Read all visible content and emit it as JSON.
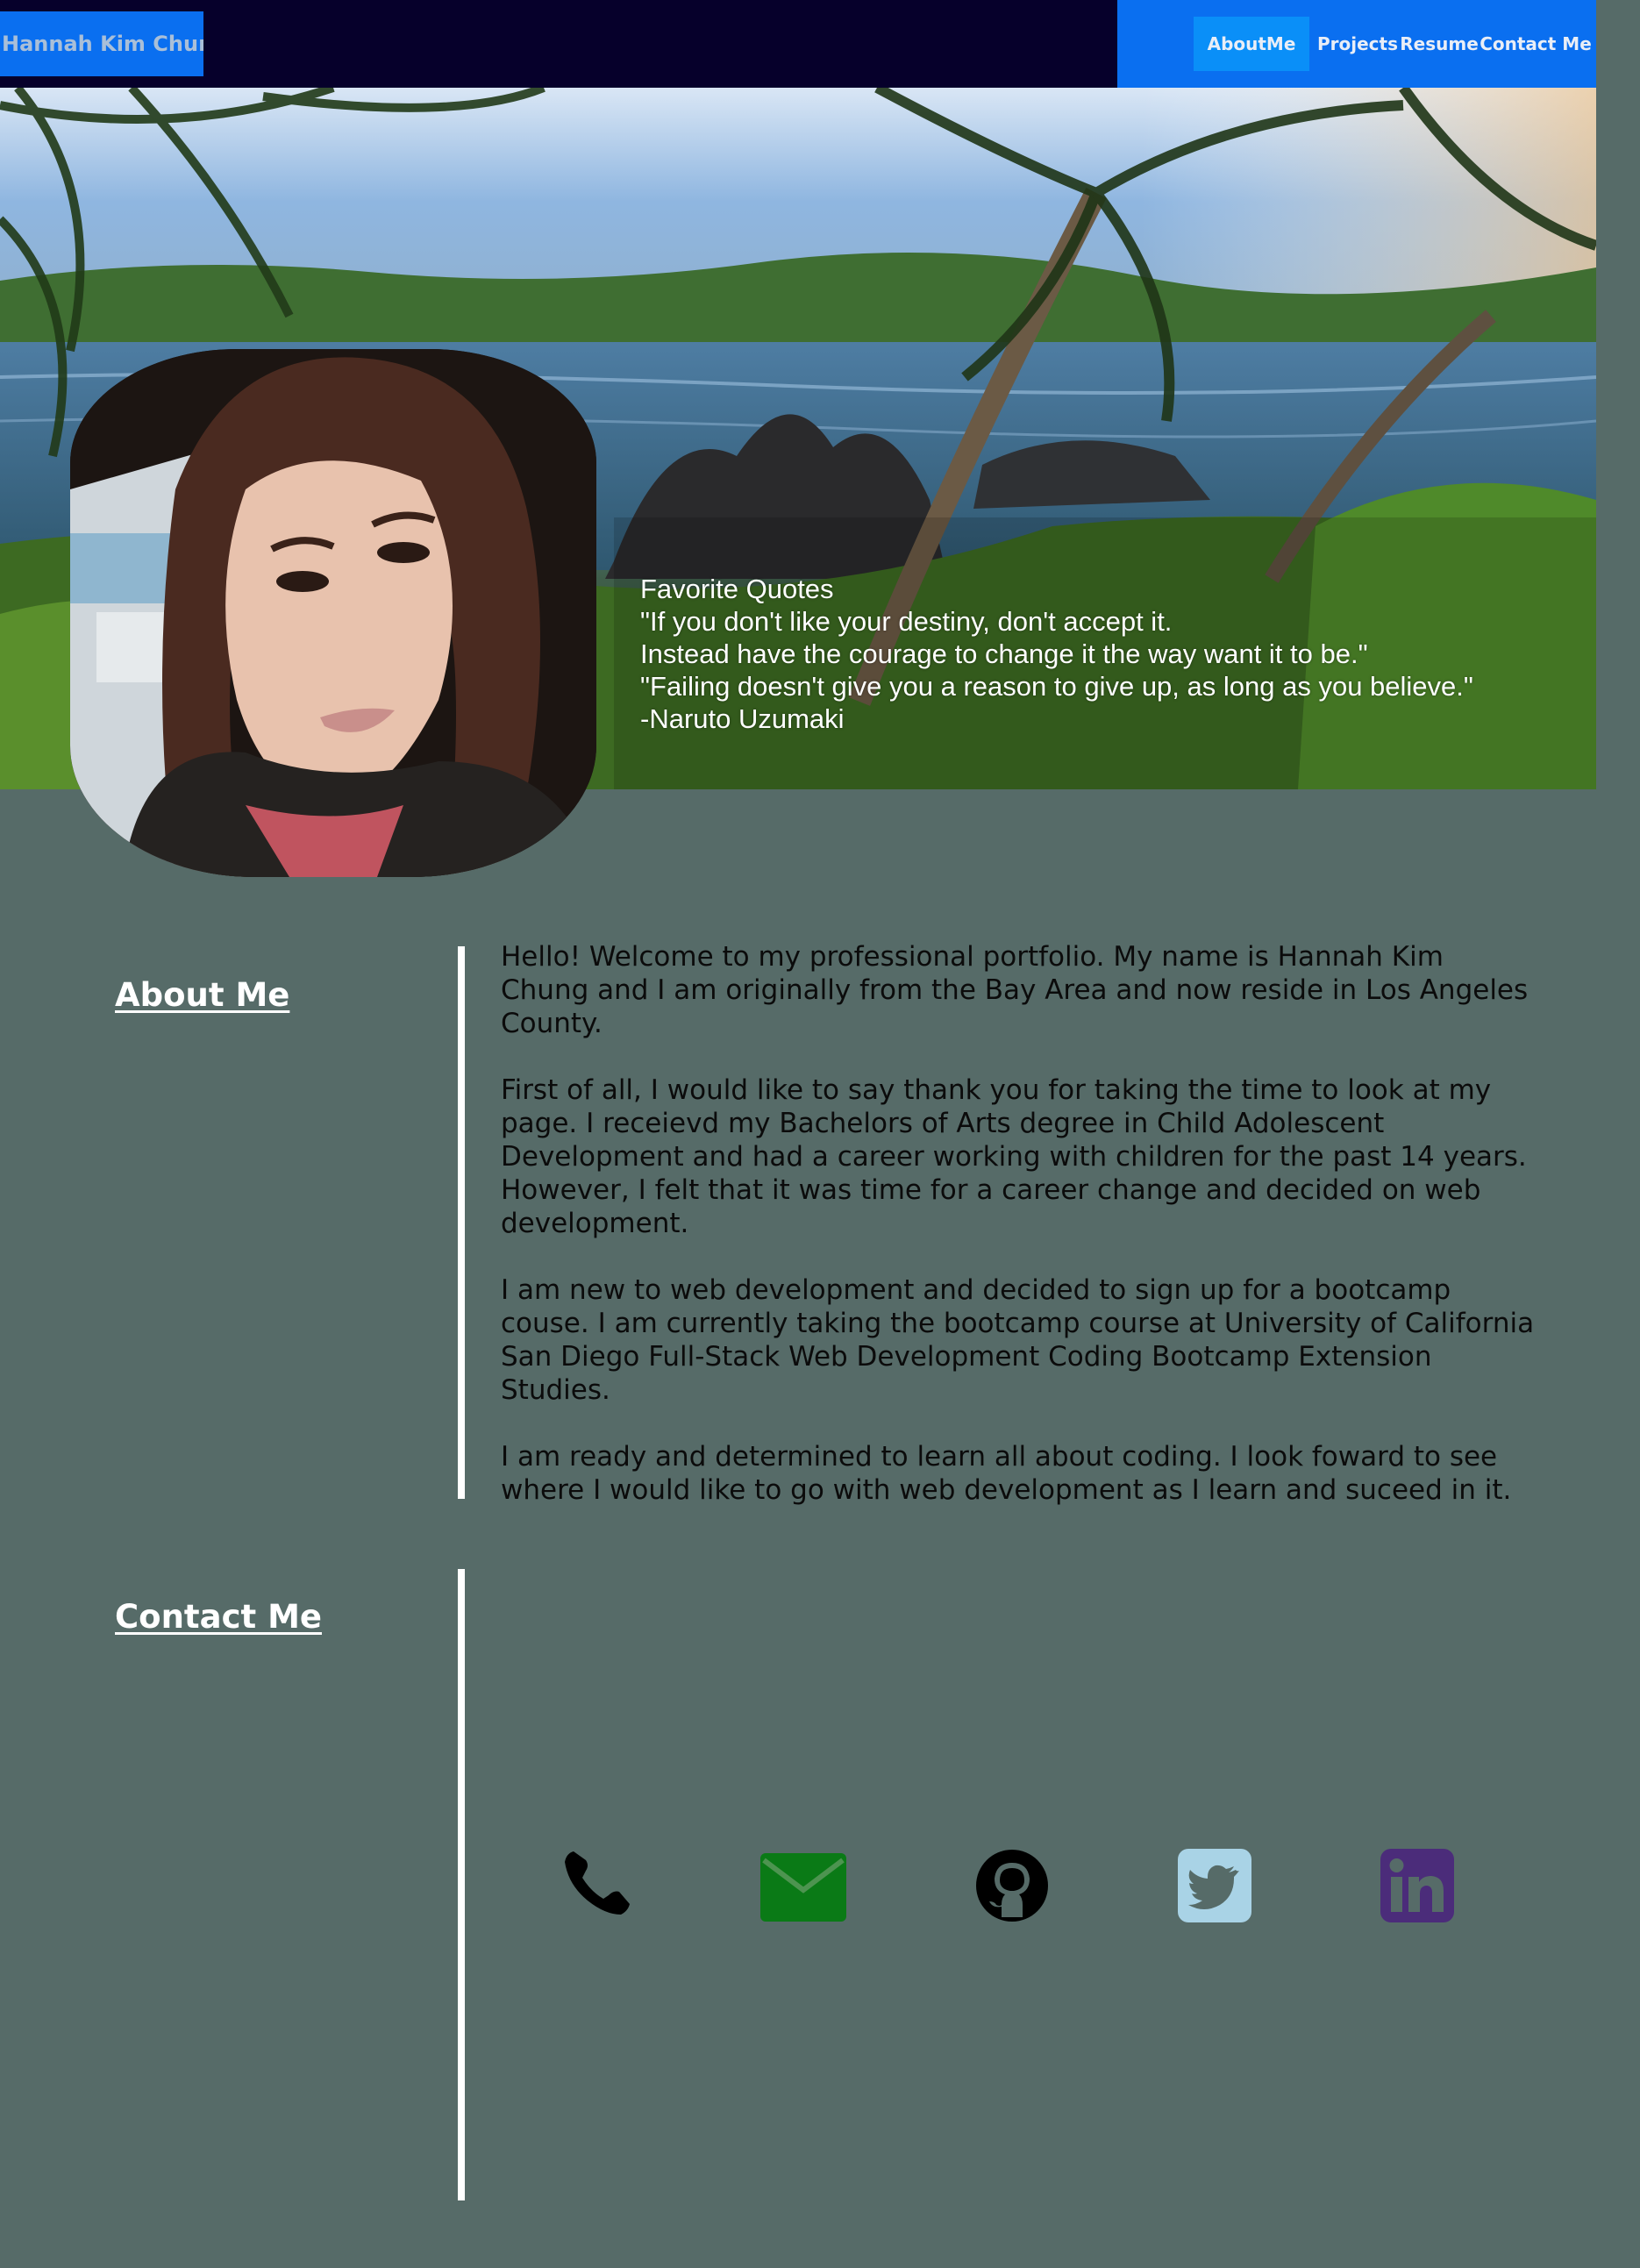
{
  "header": {
    "brand": "Hannah Kim Chung",
    "nav": [
      {
        "label": "AboutMe",
        "active": true
      },
      {
        "label": "Projects",
        "active": false
      },
      {
        "label": "Resume",
        "active": false
      },
      {
        "label": "Contact Me",
        "active": false
      }
    ]
  },
  "hero": {
    "quotes": [
      "Favorite Quotes",
      "\"If you don't like your destiny, don't accept it.",
      "Instead have the courage to change it the way want it to be.\"",
      "\"Failing doesn't give you a reason to give up, as long as you believe.\"",
      "-Naruto Uzumaki"
    ]
  },
  "about": {
    "title": "About Me",
    "paragraphs": [
      "Hello! Welcome to my professional portfolio. My name is Hannah Kim Chung and I am originally from the Bay Area and now reside in Los Angeles County.",
      "First of all, I would like to say thank you for taking the time to look at my page. I receievd my Bachelors of Arts degree in Child Adolescent Development and had a career working with children for the past 14 years. However, I felt that it was time for a career change and decided on web development.",
      "I am new to web development and decided to sign up for a bootcamp couse. I am currently taking the bootcamp course at University of California San Diego Full-Stack Web Development Coding Bootcamp Extension Studies.",
      "I am ready and determined to learn all about coding. I look foward to see where I would like to go with web development as I learn and suceed in it."
    ]
  },
  "contact": {
    "title": "Contact Me",
    "icons": [
      {
        "name": "phone-icon",
        "color": "#000000"
      },
      {
        "name": "envelope-icon",
        "color": "#0a7a16"
      },
      {
        "name": "github-icon",
        "color": "#000000"
      },
      {
        "name": "twitter-icon",
        "color": "#a9d3e6"
      },
      {
        "name": "linkedin-icon",
        "color": "#4b2c7a"
      }
    ]
  },
  "colors": {
    "page_bg": "#566b68",
    "header_bg": "#06002b",
    "nav_bg": "#0a6ff0",
    "nav_active_bg": "#0a8ff8"
  }
}
